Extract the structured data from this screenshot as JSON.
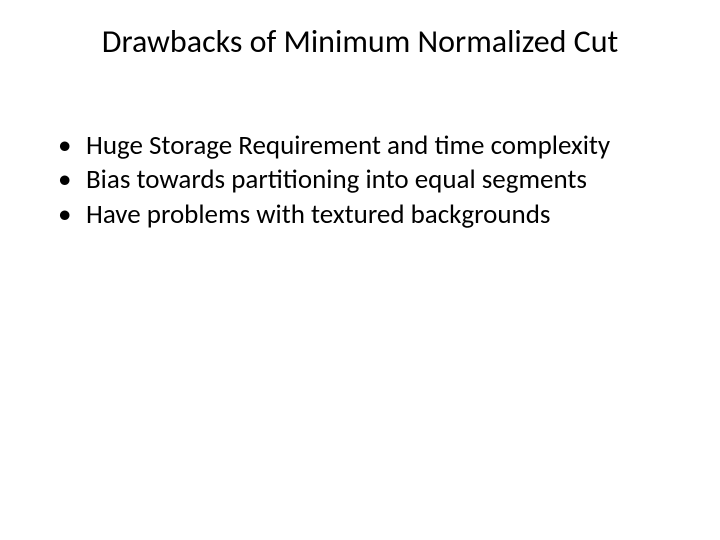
{
  "slide": {
    "title": "Drawbacks of Minimum Normalized Cut",
    "bullets": [
      "Huge Storage Requirement and time complexity",
      "Bias towards partitioning into equal segments",
      "Have problems with textured backgrounds"
    ],
    "bullet_glyph": "•"
  }
}
